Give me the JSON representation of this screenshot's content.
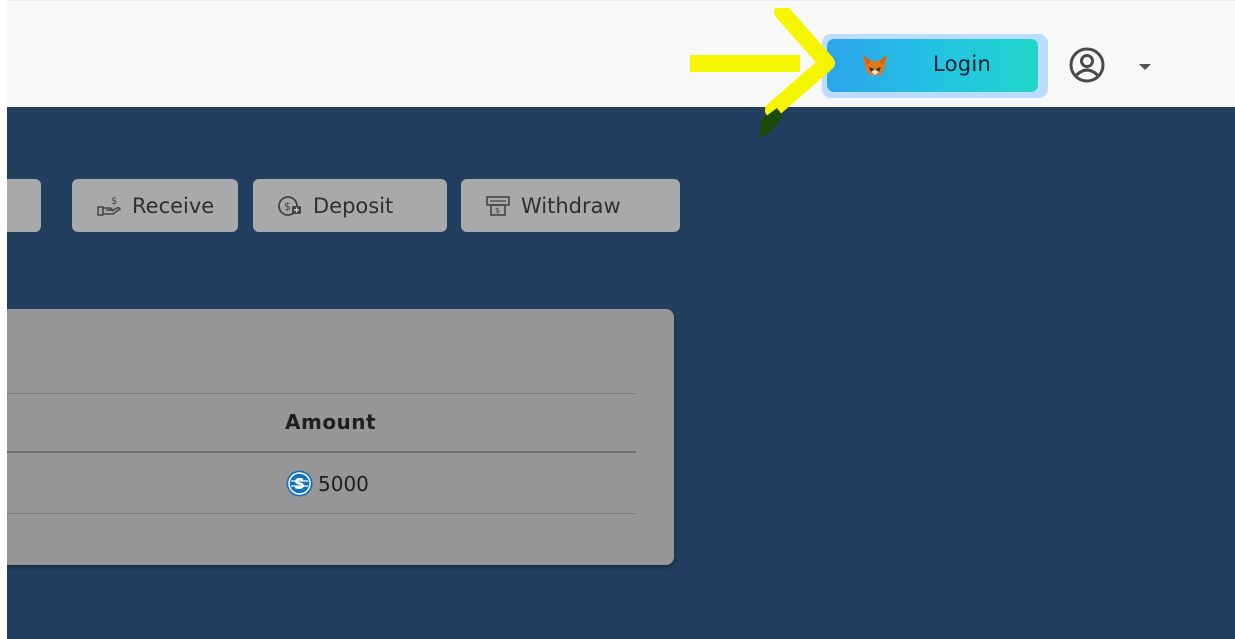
{
  "header": {
    "login_label": "Login"
  },
  "actions": {
    "receive": "Receive",
    "deposit": "Deposit",
    "withdraw": "Withdraw"
  },
  "table": {
    "headers": [
      "Amount"
    ],
    "rows": [
      {
        "amount": "5000"
      }
    ]
  },
  "icons": {
    "login": "fox-icon",
    "user": "user-icon",
    "receive": "receive-hand-icon",
    "deposit": "deposit-coin-icon",
    "withdraw": "atm-withdraw-icon",
    "amount": "coin-icon"
  },
  "colors": {
    "main_bg": "#223f5f",
    "login_gradient_start": "#2ba5ec",
    "login_gradient_end": "#1fd6c9",
    "annotation_arrow": "#f5f500",
    "action_button": "#a7a9ab",
    "card": "#969696"
  }
}
